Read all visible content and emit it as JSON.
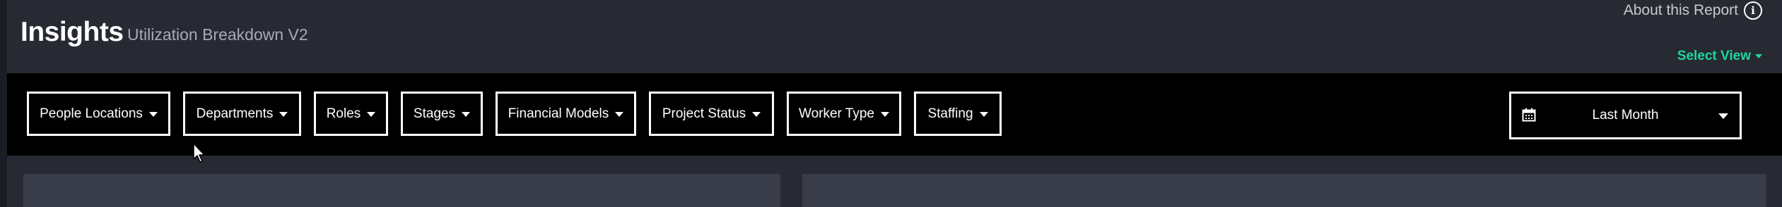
{
  "header": {
    "title": "Insights",
    "subtitle": "Utilization Breakdown V2",
    "about_label": "About this Report",
    "about_icon": "info-icon",
    "select_view_label": "Select View",
    "accent_color": "#1fd69a"
  },
  "filters": [
    {
      "label": "People Locations"
    },
    {
      "label": "Departments"
    },
    {
      "label": "Roles"
    },
    {
      "label": "Stages"
    },
    {
      "label": "Financial Models"
    },
    {
      "label": "Project Status"
    },
    {
      "label": "Worker Type"
    },
    {
      "label": "Staffing"
    }
  ],
  "date_range": {
    "label": "Last Month",
    "icon": "calendar-icon"
  }
}
